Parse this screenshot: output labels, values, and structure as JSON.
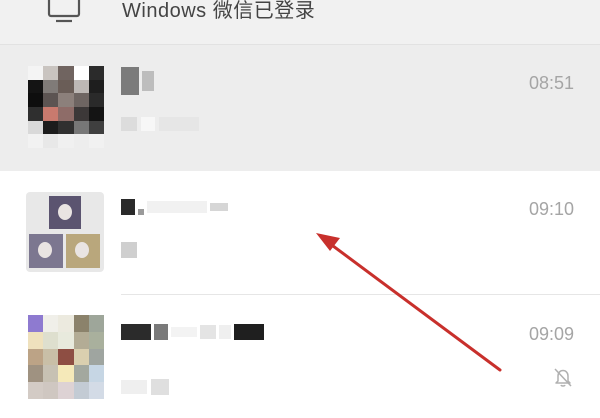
{
  "banner": {
    "text": "Windows 微信已登录",
    "icon": "monitor-icon"
  },
  "chats": [
    {
      "time": "08:51",
      "muted": false,
      "avatar": "pixelated-avatar"
    },
    {
      "time": "09:10",
      "muted": false,
      "avatar": "group-avatar"
    },
    {
      "time": "09:09",
      "muted": true,
      "avatar": "pixelated-group-avatar"
    }
  ],
  "colors": {
    "arrow": "#c8302c",
    "time_text": "#a5a5a5",
    "selected_row_bg": "#ededed"
  },
  "icons": {
    "mute": "bell-slash-icon"
  }
}
